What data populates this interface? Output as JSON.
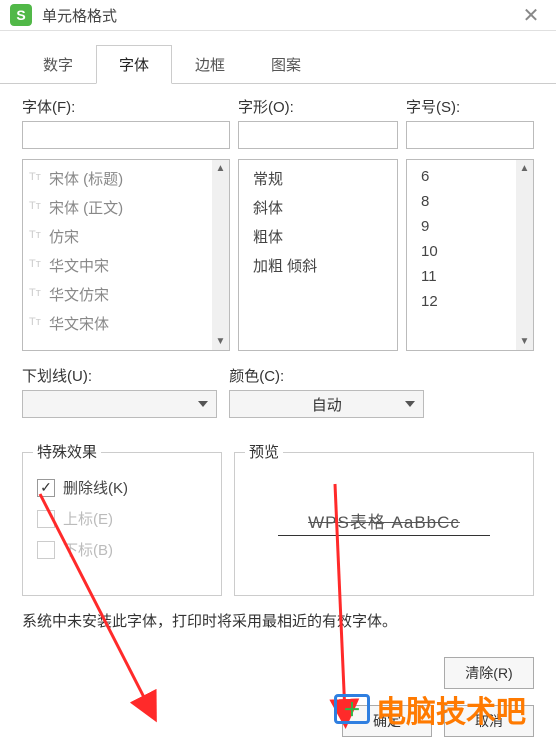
{
  "titlebar": {
    "icon_letter": "S",
    "title": "单元格格式"
  },
  "tabs": [
    {
      "label": "数字",
      "active": false
    },
    {
      "label": "字体",
      "active": true
    },
    {
      "label": "边框",
      "active": false
    },
    {
      "label": "图案",
      "active": false
    }
  ],
  "labels": {
    "font": "字体(F):",
    "style": "字形(O):",
    "size": "字号(S):",
    "underline": "下划线(U):",
    "color": "颜色(C):",
    "effects": "特殊效果",
    "preview": "预览"
  },
  "font_input": "",
  "style_input": "",
  "size_input": "",
  "font_list": [
    "宋体 (标题)",
    "宋体 (正文)",
    "仿宋",
    "华文中宋",
    "华文仿宋",
    "华文宋体"
  ],
  "style_list": [
    "常规",
    "斜体",
    "粗体",
    "加粗 倾斜"
  ],
  "size_list": [
    "6",
    "8",
    "9",
    "10",
    "11",
    "12"
  ],
  "underline_value": "",
  "color_value": "自动",
  "effects_items": [
    {
      "label": "删除线(K)",
      "checked": true,
      "disabled": false
    },
    {
      "label": "上标(E)",
      "checked": false,
      "disabled": true
    },
    {
      "label": "下标(B)",
      "checked": false,
      "disabled": true
    }
  ],
  "preview_text": "WPS表格  AaBbCc",
  "note": "系统中未安装此字体，打印时将采用最相近的有效字体。",
  "buttons": {
    "clear": "清除(R)",
    "ok": "确定",
    "cancel": "取消"
  },
  "watermark": "电脑技术吧"
}
